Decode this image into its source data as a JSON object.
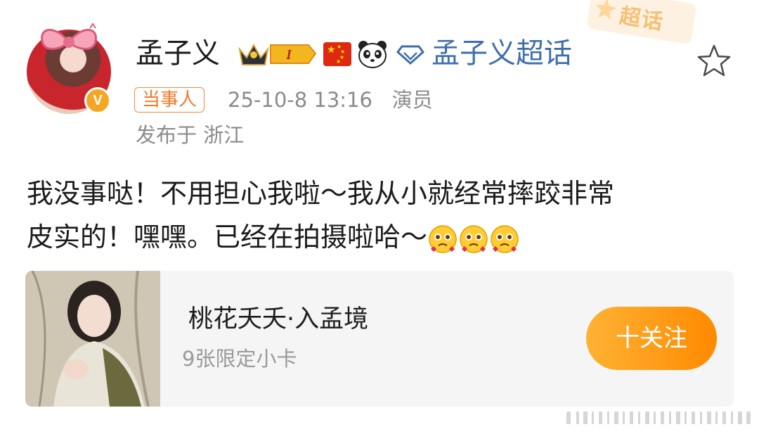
{
  "stamp": {
    "label": "超话"
  },
  "author": {
    "name": "孟子义",
    "level_badge": "I",
    "super_topic": "孟子义超话"
  },
  "meta": {
    "tag": "当事人",
    "timestamp_and_role": "25-10-8 13:16   演员",
    "location": "发布于 浙江"
  },
  "post": {
    "text_line1": "我没事哒！不用担心我啦～我从小就经常摔跤非常",
    "text_line2": "皮实的！嘿嘿。已经在拍摄啦哈～"
  },
  "card": {
    "title": "桃花夭夭·入孟境",
    "subtitle": "9张限定小卡",
    "follow_label": "十关注"
  },
  "colors": {
    "link": "#3f6fab",
    "tag": "#f07a2a",
    "follow": "#ff9a1a"
  }
}
